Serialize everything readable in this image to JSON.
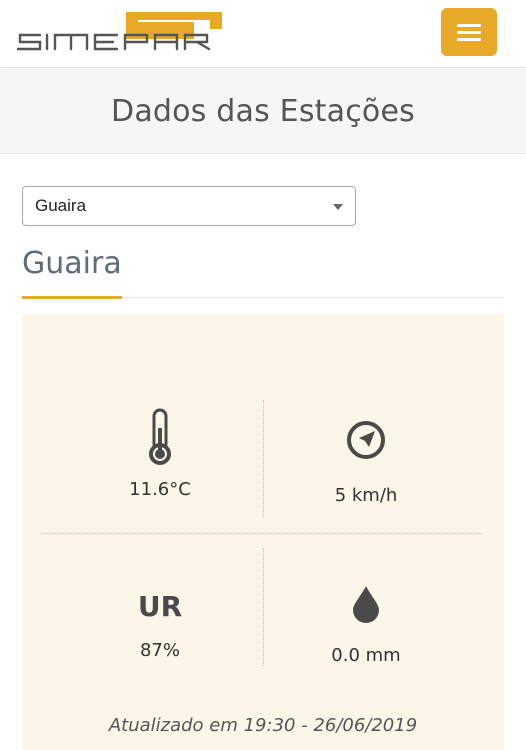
{
  "header": {
    "logo_text": "SIMEPAR",
    "menu_icon": "hamburger-icon"
  },
  "page": {
    "title": "Dados das Estações"
  },
  "station_select": {
    "selected": "Guaira"
  },
  "station": {
    "name": "Guaira"
  },
  "readings": {
    "temperature": "11.6°C",
    "wind": "5 km/h",
    "humidity_label": "UR",
    "humidity": "87%",
    "rain": "0.0 mm"
  },
  "icons": {
    "temperature": "thermometer-icon",
    "wind": "compass-icon",
    "rain": "drop-icon"
  },
  "updated": "Atualizado em 19:30 - 26/06/2019",
  "colors": {
    "accent": "#e8a928",
    "panel_bg": "#fbf6e7",
    "icon": "#4a4a4a"
  }
}
